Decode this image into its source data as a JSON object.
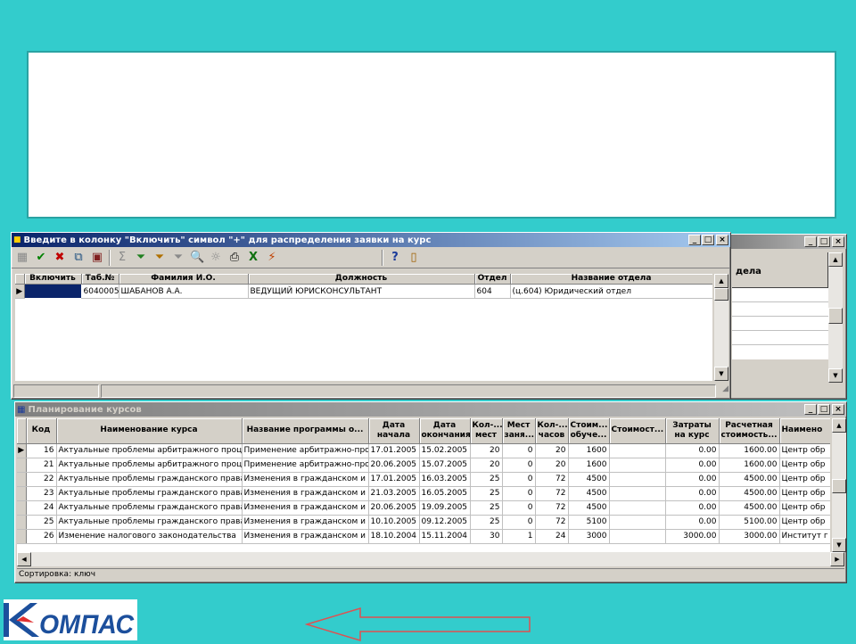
{
  "dialog": {
    "title": "Введите в колонку \"Включить\" символ \"+\" для распределения заявки на курс",
    "toolbar_icons": [
      "grid-icon",
      "check-icon",
      "cross-icon",
      "copy-record-icon",
      "save-record-icon",
      "sum-icon",
      "filter-icon",
      "filter-edit-icon",
      "filter-clear-icon",
      "preview-icon",
      "bulb-icon",
      "print-icon",
      "excel-icon",
      "action-icon",
      "help-icon",
      "exit-icon"
    ],
    "columns": [
      "Включить",
      "Таб.№",
      "Фамилия И.О.",
      "Должность",
      "Отдел",
      "Название отдела"
    ],
    "rows": [
      [
        "",
        "6040005",
        "ШАБАНОВ А.А.",
        "ВЕДУЩИЙ ЮРИСКОНСУЛЬТАНТ",
        "604",
        "(ц.604) Юридический отдел"
      ]
    ]
  },
  "back_window": {
    "column_fragment": "дела"
  },
  "courses": {
    "title": "Планирование курсов",
    "columns": [
      "Код",
      "Наименование курса",
      "Название программы о...",
      "Дата начала",
      "Дата окончания",
      "Кол-... мест",
      "Мест заня...",
      "Кол-... часов",
      "Стоим... обуче...",
      "Стоимост...",
      "Затраты на курс",
      "Расчетная стоимость...",
      "Наимено"
    ],
    "rows": [
      [
        "16",
        "Актуальные проблемы арбитражного проце",
        "Применение арбитражно-прог",
        "17.01.2005",
        "15.02.2005",
        "20",
        "0",
        "20",
        "1600",
        "",
        "0.00",
        "1600.00",
        "Центр обр"
      ],
      [
        "21",
        "Актуальные проблемы арбитражного проце",
        "Применение арбитражно-прог",
        "20.06.2005",
        "15.07.2005",
        "20",
        "0",
        "20",
        "1600",
        "",
        "0.00",
        "1600.00",
        "Центр обр"
      ],
      [
        "22",
        "Актуальные проблемы гражданского права",
        "Изменения в гражданском и",
        "17.01.2005",
        "16.03.2005",
        "25",
        "0",
        "72",
        "4500",
        "",
        "0.00",
        "4500.00",
        "Центр обр"
      ],
      [
        "23",
        "Актуальные проблемы гражданского права",
        "Изменения в гражданском и",
        "21.03.2005",
        "16.05.2005",
        "25",
        "0",
        "72",
        "4500",
        "",
        "0.00",
        "4500.00",
        "Центр обр"
      ],
      [
        "24",
        "Актуальные проблемы гражданского права",
        "Изменения в гражданском и",
        "20.06.2005",
        "19.09.2005",
        "25",
        "0",
        "72",
        "4500",
        "",
        "0.00",
        "4500.00",
        "Центр обр"
      ],
      [
        "25",
        "Актуальные проблемы гражданского права",
        "Изменения в гражданском и",
        "10.10.2005",
        "09.12.2005",
        "25",
        "0",
        "72",
        "5100",
        "",
        "0.00",
        "5100.00",
        "Центр обр"
      ],
      [
        "26",
        "Изменение налогового законодательства",
        "Изменения в гражданском и",
        "18.10.2004",
        "15.11.2004",
        "30",
        "1",
        "24",
        "3000",
        "",
        "3000.00",
        "3000.00",
        "Институт г"
      ]
    ],
    "status": "Сортировка: ключ"
  },
  "window_buttons": {
    "minimize": "_",
    "maximize": "□",
    "close": "×"
  },
  "logo_text": "КОМПАС",
  "colors": {
    "background": "#33cccc",
    "title_active": "#0a246a",
    "logo_blue": "#1c4f9c",
    "arrow": "#e05050"
  }
}
